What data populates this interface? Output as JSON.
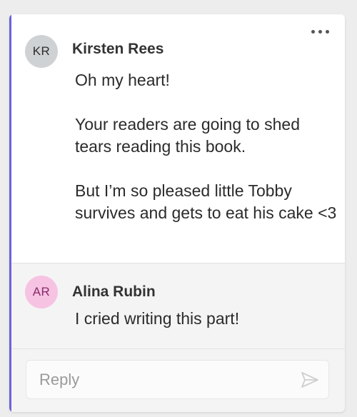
{
  "comment": {
    "author_initials": "KR",
    "author_name": "Kirsten Rees",
    "paragraphs": [
      "Oh my heart!",
      "Your readers are going to shed tears reading this book.",
      "But I’m so pleased little Tobby survives and gets to eat his cake <3"
    ],
    "more_icon": "more-horizontal-icon"
  },
  "reply": {
    "author_initials": "AR",
    "author_name": "Alina Rubin",
    "text": "I cried writing this part!"
  },
  "reply_input": {
    "placeholder": "Reply",
    "value": "",
    "send_icon": "send-icon"
  },
  "colors": {
    "accent": "#6d62d6",
    "avatar_kr_bg": "#cfd2d5",
    "avatar_ar_bg": "#f6c3e3",
    "avatar_ar_text": "#8a2a6a"
  }
}
